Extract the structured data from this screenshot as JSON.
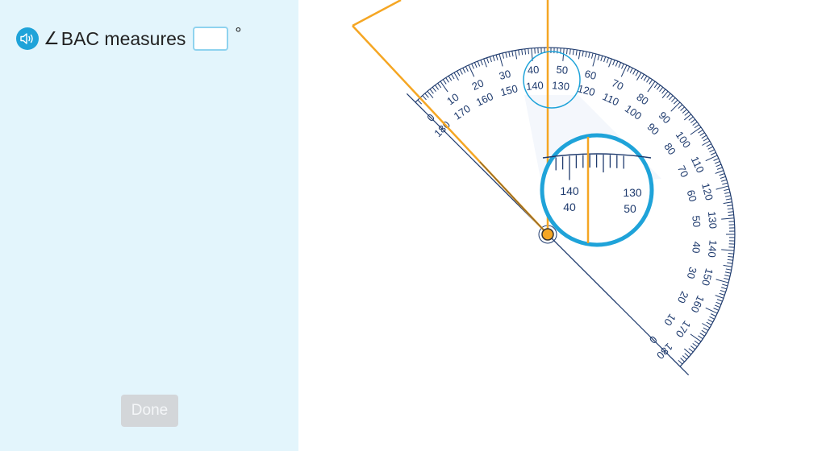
{
  "question": {
    "audio_icon": "speaker-icon",
    "angle_symbol": "∠",
    "prompt": "BAC measures",
    "answer_value": "",
    "degree_symbol": "°"
  },
  "done_button": {
    "label": "Done",
    "enabled": false
  },
  "protractor": {
    "outer_labels": [
      "0",
      "10",
      "20",
      "30",
      "40",
      "50",
      "60",
      "70",
      "80",
      "90",
      "100",
      "110",
      "120",
      "130",
      "140",
      "150",
      "160",
      "170",
      "180"
    ],
    "inner_labels": [
      "180",
      "170",
      "160",
      "150",
      "140",
      "130",
      "120",
      "110",
      "100",
      "90",
      "80",
      "70",
      "60",
      "50",
      "40",
      "30",
      "20",
      "10",
      "0"
    ],
    "zoom_outer_labels": [
      "140",
      "130"
    ],
    "zoom_inner_labels": [
      "40",
      "50"
    ]
  },
  "colors": {
    "panel": "#e3f5fc",
    "ray": "#f5a623",
    "protractor_line": "#1f3b6e",
    "magnifier": "#1fa3d9"
  }
}
